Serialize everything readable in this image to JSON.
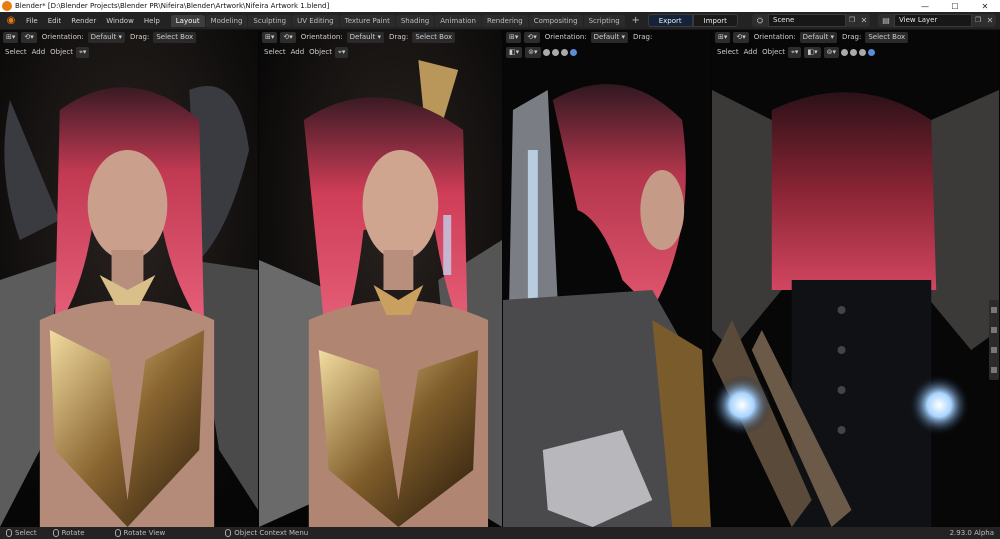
{
  "titlebar": {
    "title": "Blender* [D:\\Blender Projects\\Blender PR\\Nifeira\\Blender\\Artwork\\Nifeira Artwork 1.blend]",
    "minimize": "—",
    "maximize": "☐",
    "close": "✕"
  },
  "menu": [
    "File",
    "Edit",
    "Render",
    "Window",
    "Help"
  ],
  "workspaces": [
    {
      "label": "Layout",
      "active": true
    },
    {
      "label": "Modeling"
    },
    {
      "label": "Sculpting"
    },
    {
      "label": "UV Editing"
    },
    {
      "label": "Texture Paint"
    },
    {
      "label": "Shading"
    },
    {
      "label": "Animation"
    },
    {
      "label": "Rendering"
    },
    {
      "label": "Compositing"
    },
    {
      "label": "Scripting"
    }
  ],
  "export_label": "Export",
  "import_label": "Import",
  "scene": {
    "value": "Scene"
  },
  "view_layer": {
    "value": "View Layer"
  },
  "viewport_header": {
    "orientation_label": "Orientation:",
    "orientation_value": "Default",
    "drag_label": "Drag:",
    "drag_value": "Select Box",
    "select": "Select",
    "add": "Add",
    "object": "Object"
  },
  "status": {
    "select": "Select",
    "rotate": "Rotate",
    "rotate_view": "Rotate View",
    "context": "Object Context Menu",
    "version": "2.93.0 Alpha"
  },
  "colors": {
    "accent": "#e87d0d",
    "active_blue": "#3b6fb6",
    "hair": "#d9475f",
    "gold": "#c9a35a"
  }
}
